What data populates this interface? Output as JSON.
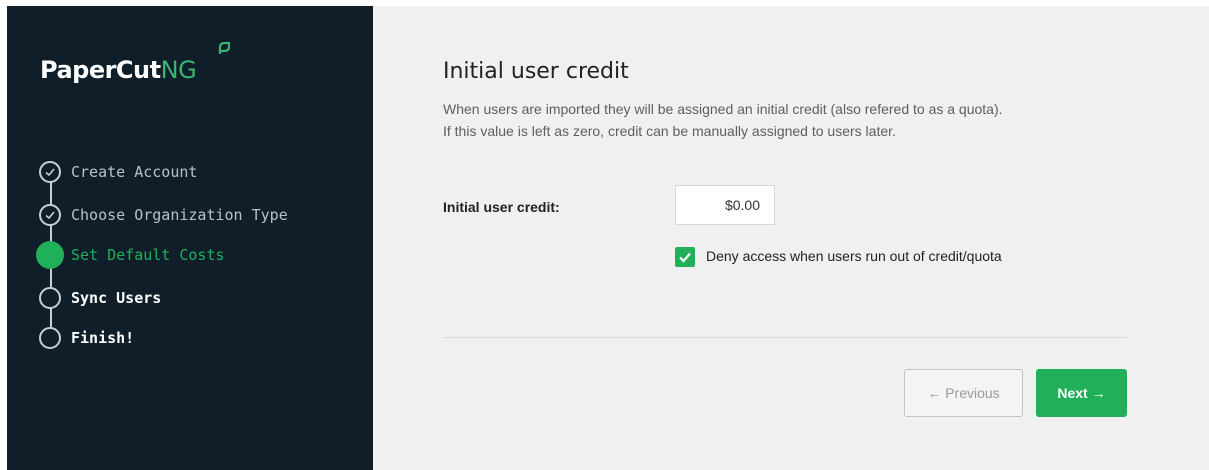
{
  "sidebar": {
    "brand": {
      "main": "PaperCut",
      "suffix": "NG",
      "logo_icon": "leaf-icon"
    },
    "steps": [
      {
        "label": "Create Account",
        "state": "completed",
        "icon": "check-circle-icon"
      },
      {
        "label": "Choose Organization Type",
        "state": "completed",
        "icon": "check-circle-icon"
      },
      {
        "label": "Set Default Costs",
        "state": "active",
        "icon": "filled-circle-icon"
      },
      {
        "label": "Sync Users",
        "state": "pending",
        "icon": "empty-circle-icon"
      },
      {
        "label": "Finish!",
        "state": "pending",
        "icon": "empty-circle-icon"
      }
    ]
  },
  "main": {
    "title": "Initial user credit",
    "description": [
      "When users are imported they will be assigned an initial credit (also refered to as a quota).",
      "If this value is left as zero, credit can be manually assigned to users later."
    ],
    "credit_field": {
      "label": "Initial user credit:",
      "value": "$0.00"
    },
    "deny_access": {
      "label": "Deny access when users run out of credit/quota",
      "checked": true
    },
    "buttons": {
      "previous": "← Previous",
      "next": "Next →"
    }
  },
  "colors": {
    "accent": "#20b05a",
    "sidebar_bg": "#101e2a",
    "main_bg": "#f0f0f0"
  }
}
